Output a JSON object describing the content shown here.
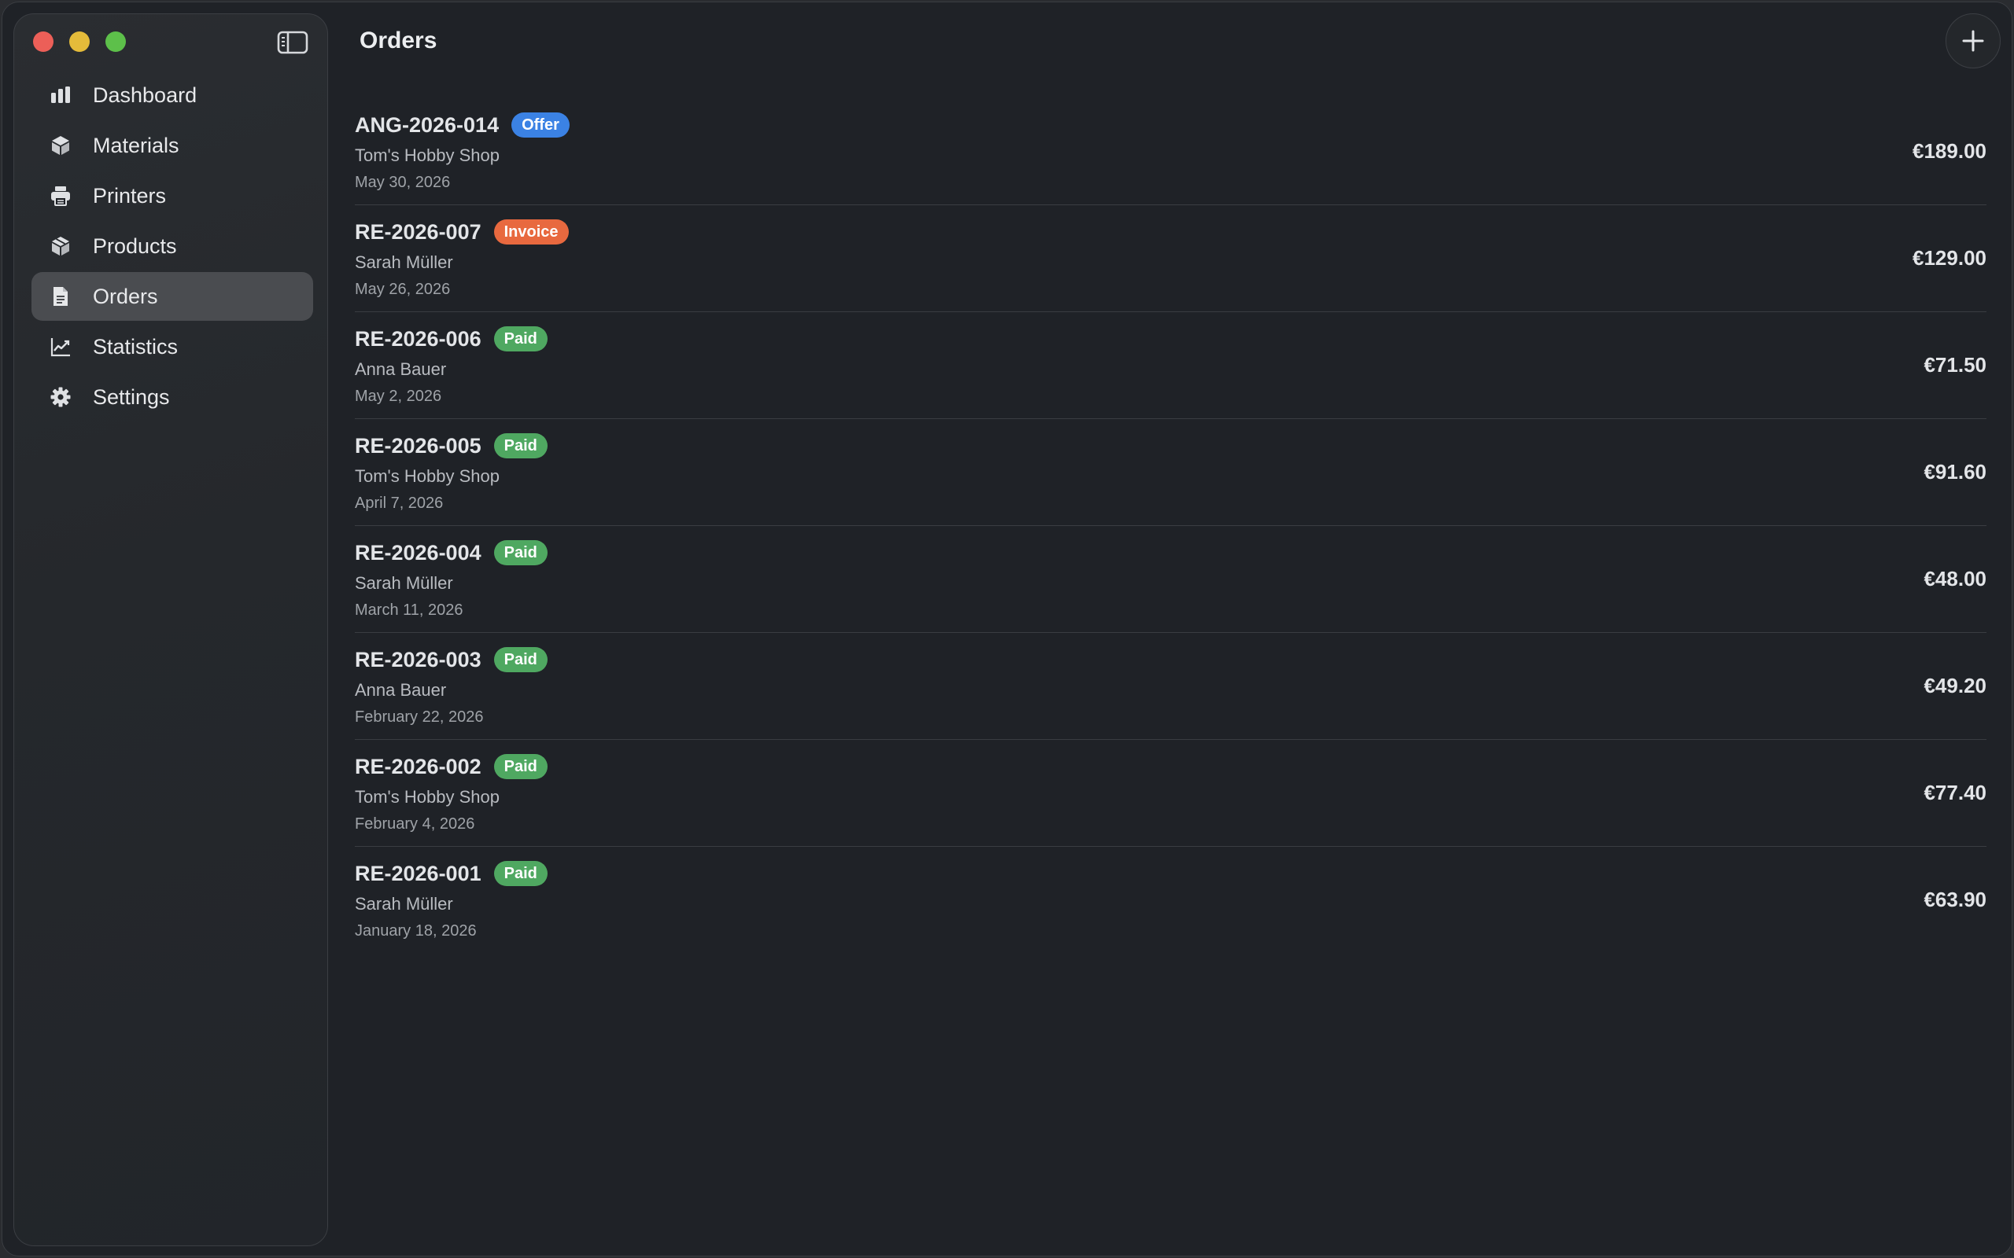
{
  "window": {
    "controls": [
      "close",
      "minimize",
      "maximize"
    ]
  },
  "sidebar": {
    "toggle_icon": "sidebar-toggle-icon",
    "items": [
      {
        "label": "Dashboard",
        "icon": "chart-bar-icon",
        "active": false
      },
      {
        "label": "Materials",
        "icon": "cube-icon",
        "active": false
      },
      {
        "label": "Printers",
        "icon": "printer-icon",
        "active": false
      },
      {
        "label": "Products",
        "icon": "box-icon",
        "active": false
      },
      {
        "label": "Orders",
        "icon": "document-icon",
        "active": true
      },
      {
        "label": "Statistics",
        "icon": "line-chart-icon",
        "active": false
      },
      {
        "label": "Settings",
        "icon": "gear-icon",
        "active": false
      }
    ]
  },
  "header": {
    "title": "Orders",
    "add_icon": "plus-icon"
  },
  "colors": {
    "offer": "#3b82e4",
    "invoice": "#e8693f",
    "paid": "#4fa861"
  },
  "orders": [
    {
      "number": "ANG-2026-014",
      "status": "Offer",
      "status_type": "offer",
      "customer": "Tom's Hobby Shop",
      "date": "May 30, 2026",
      "amount": "€189.00"
    },
    {
      "number": "RE-2026-007",
      "status": "Invoice",
      "status_type": "invoice",
      "customer": "Sarah Müller",
      "date": "May 26, 2026",
      "amount": "€129.00"
    },
    {
      "number": "RE-2026-006",
      "status": "Paid",
      "status_type": "paid",
      "customer": "Anna Bauer",
      "date": "May 2, 2026",
      "amount": "€71.50"
    },
    {
      "number": "RE-2026-005",
      "status": "Paid",
      "status_type": "paid",
      "customer": "Tom's Hobby Shop",
      "date": "April 7, 2026",
      "amount": "€91.60"
    },
    {
      "number": "RE-2026-004",
      "status": "Paid",
      "status_type": "paid",
      "customer": "Sarah Müller",
      "date": "March 11, 2026",
      "amount": "€48.00"
    },
    {
      "number": "RE-2026-003",
      "status": "Paid",
      "status_type": "paid",
      "customer": "Anna Bauer",
      "date": "February 22, 2026",
      "amount": "€49.20"
    },
    {
      "number": "RE-2026-002",
      "status": "Paid",
      "status_type": "paid",
      "customer": "Tom's Hobby Shop",
      "date": "February 4, 2026",
      "amount": "€77.40"
    },
    {
      "number": "RE-2026-001",
      "status": "Paid",
      "status_type": "paid",
      "customer": "Sarah Müller",
      "date": "January 18, 2026",
      "amount": "€63.90"
    }
  ]
}
